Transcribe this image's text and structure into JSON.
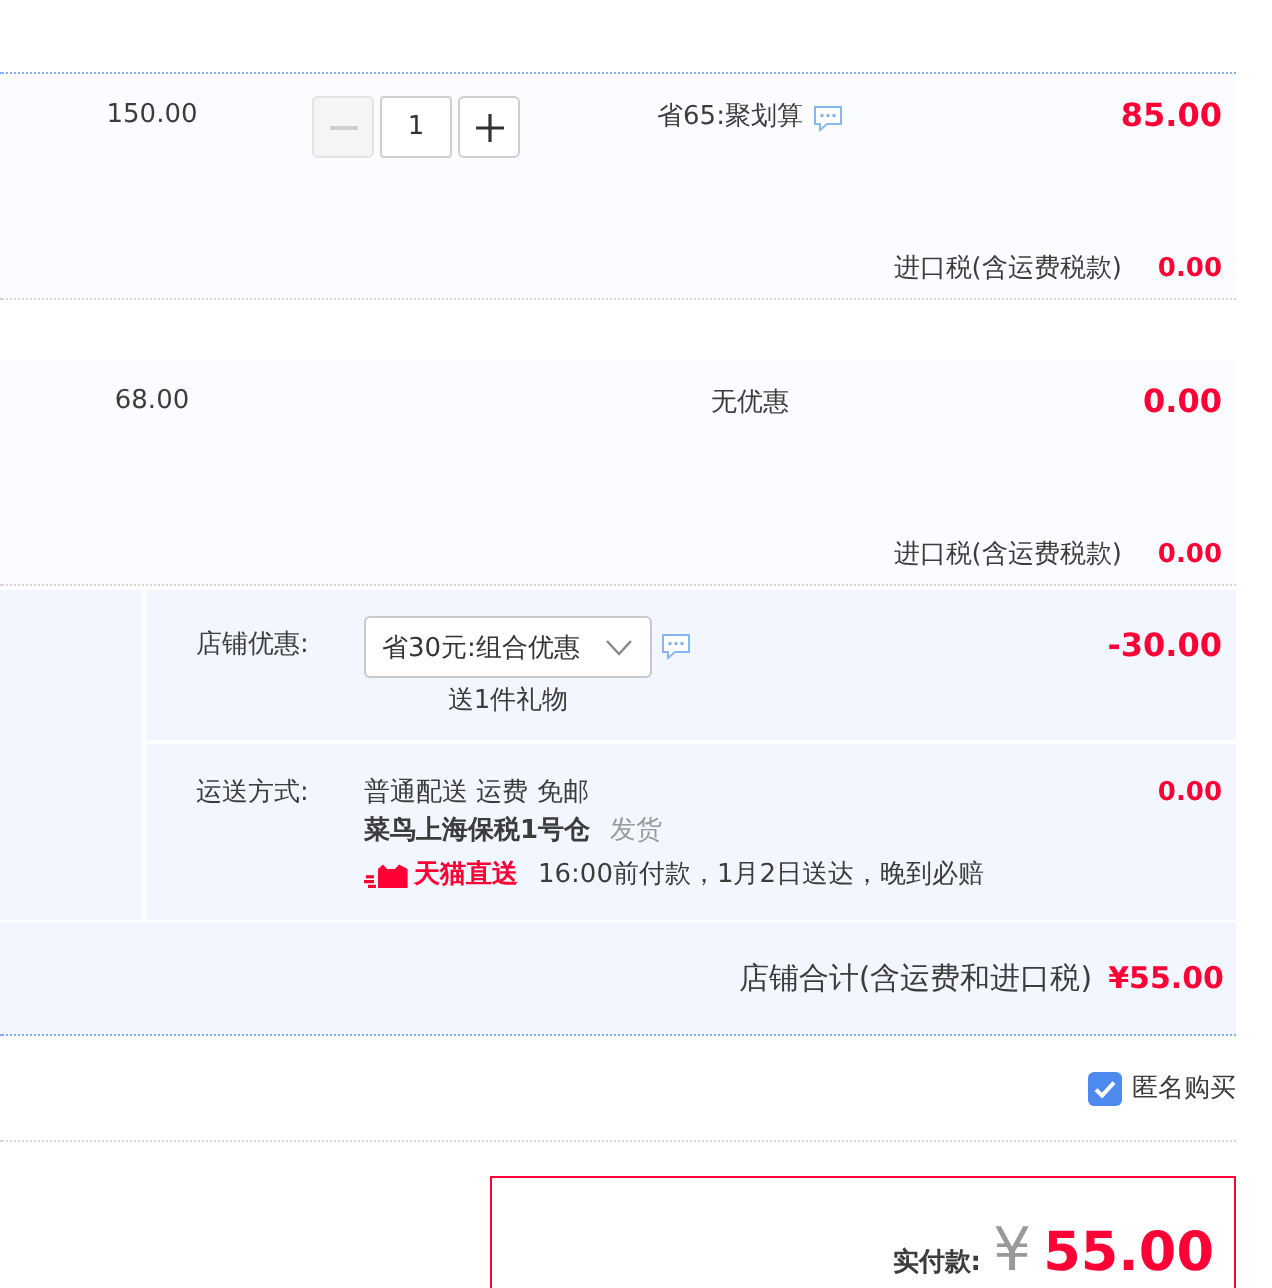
{
  "items": [
    {
      "unit_price": "150.00",
      "quantity": {
        "decrease_disabled": true,
        "value": "1",
        "increase_disabled": false
      },
      "promo": "省65:聚划算",
      "promo_info": true,
      "subtotal": "85.00",
      "tax_label": "进口税(含运费税款)",
      "tax": "0.00"
    },
    {
      "unit_price": "68.00",
      "promo": "无优惠",
      "promo_info": false,
      "subtotal": "0.00",
      "tax_label": "进口税(含运费税款)",
      "tax": "0.00"
    }
  ],
  "store": {
    "discount": {
      "label": "店铺优惠:",
      "selected_offer": "省30元:组合优惠",
      "info": true,
      "gift_note": "送1件礼物",
      "amount": "-30.00"
    },
    "shipping": {
      "label": "运送方式:",
      "method": "普通配送 运费 免邮",
      "warehouse": "菜鸟上海保税1号仓",
      "dispatch": "发货",
      "delivery_brand": "天猫直送",
      "promise": "16:00前付款，1月2日送达，晚到必赔",
      "amount": "0.00"
    },
    "total": {
      "label": "店铺合计(含运费和进口税)",
      "amount": "¥55.00"
    }
  },
  "anonymous": {
    "checked": true,
    "label": "匿名购买"
  },
  "payment": {
    "label": "实付款:",
    "currency": "¥",
    "amount": "55.00"
  }
}
